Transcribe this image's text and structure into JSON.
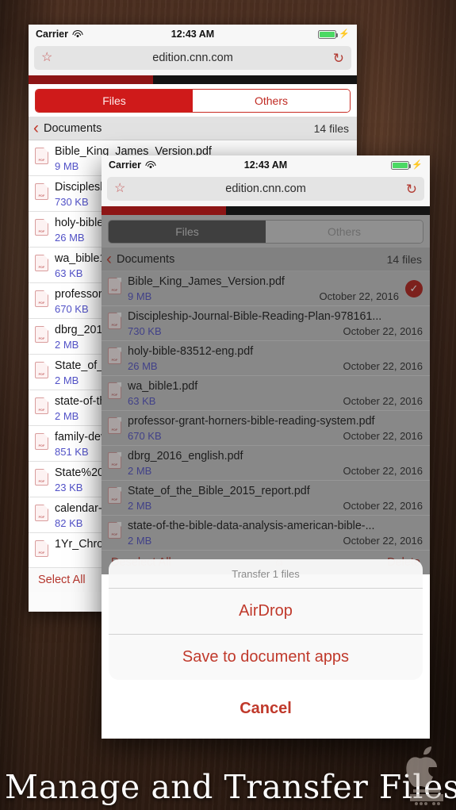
{
  "caption": {
    "text": "Manage and Transfer Files",
    "watermark": "apple-logo-watermark"
  },
  "status_bar": {
    "carrier": "Carrier",
    "time": "12:43 AM",
    "wifi_icon": "wifi-icon",
    "battery_icon": "battery-icon",
    "charging_icon": "lightning-bolt-icon"
  },
  "browser": {
    "url": "edition.cnn.com",
    "bookmark_icon": "star-icon",
    "reload_icon": "reload-icon"
  },
  "tabs": {
    "files": "Files",
    "others": "Others"
  },
  "breadcrumb": {
    "back_icon": "chevron-left-icon",
    "label": "Documents",
    "count": "14 files"
  },
  "back_phone": {
    "files": [
      {
        "name": "Bible_King_James_Version.pdf",
        "size": "9 MB"
      },
      {
        "name": "Discipleship-Journal-Bible-Reading-Plan-978161...",
        "size": "730 KB"
      },
      {
        "name": "holy-bible-83512-eng.pdf",
        "size": "26 MB"
      },
      {
        "name": "wa_bible1.pdf",
        "size": "63 KB"
      },
      {
        "name": "professor-grant-horners-bible-reading-system.pdf",
        "size": "670 KB"
      },
      {
        "name": "dbrg_2016_english.pdf",
        "size": "2 MB"
      },
      {
        "name": "State_of_the_Bible_2015_report.pdf",
        "size": "2 MB"
      },
      {
        "name": "state-of-the-bible-data-analysis-american-bible-...",
        "size": "2 MB"
      },
      {
        "name": "family-devotions-guide.pdf",
        "size": "851 KB"
      },
      {
        "name": "State%20of%20the%20Bible.pdf",
        "size": "23 KB"
      },
      {
        "name": "calendar-reading-plan.pdf",
        "size": "82 KB"
      },
      {
        "name": "1Yr_Chronological_Plan.pdf",
        "size": ""
      }
    ],
    "toolbar": {
      "select_all": "Select All"
    },
    "bottom_back_icon": "chevron-left-icon"
  },
  "front_phone": {
    "files": [
      {
        "name": "Bible_King_James_Version.pdf",
        "size": "9 MB",
        "date": "October 22, 2016",
        "selected": true
      },
      {
        "name": "Discipleship-Journal-Bible-Reading-Plan-978161...",
        "size": "730 KB",
        "date": "October 22, 2016",
        "selected": false
      },
      {
        "name": "holy-bible-83512-eng.pdf",
        "size": "26 MB",
        "date": "October 22, 2016",
        "selected": false
      },
      {
        "name": "wa_bible1.pdf",
        "size": "63 KB",
        "date": "October 22, 2016",
        "selected": false
      },
      {
        "name": "professor-grant-horners-bible-reading-system.pdf",
        "size": "670 KB",
        "date": "October 22, 2016",
        "selected": false
      },
      {
        "name": "dbrg_2016_english.pdf",
        "size": "2 MB",
        "date": "October 22, 2016",
        "selected": false
      },
      {
        "name": "State_of_the_Bible_2015_report.pdf",
        "size": "2 MB",
        "date": "October 22, 2016",
        "selected": false
      },
      {
        "name": "state-of-the-bible-data-analysis-american-bible-...",
        "size": "2 MB",
        "date": "October 22, 2016",
        "selected": false
      }
    ],
    "toolbar": {
      "deselect_all": "Deselect All",
      "share_icon": "share-icon",
      "delete": "Delete"
    },
    "action_sheet": {
      "title": "Transfer 1 files",
      "actions": [
        "AirDrop",
        "Save to document apps"
      ],
      "cancel": "Cancel"
    }
  },
  "colors": {
    "accent_red": "#cf1a1a",
    "link_blue": "#5252c8",
    "selected_badge": "#b51d16",
    "battery_green": "#4cd964"
  }
}
